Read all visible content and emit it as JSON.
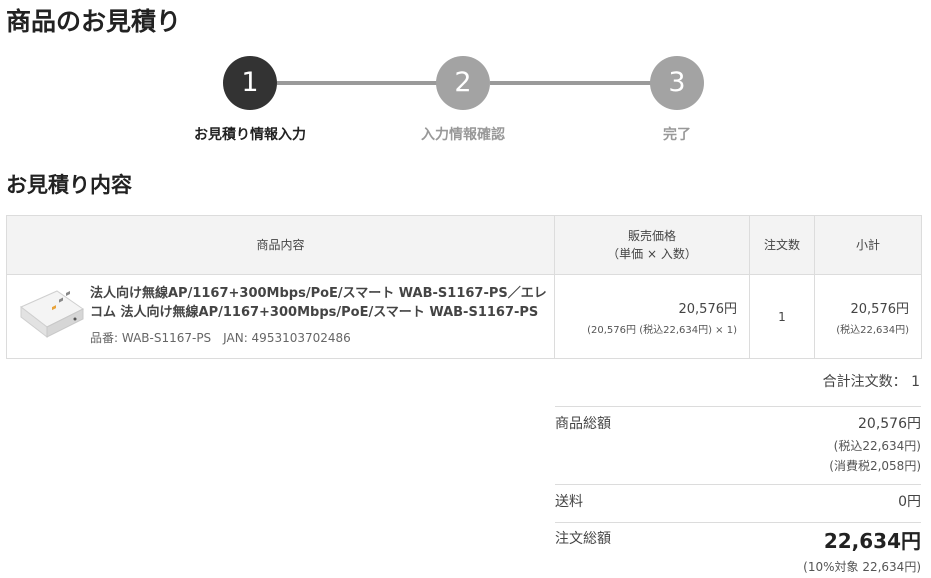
{
  "page": {
    "title": "商品のお見積り"
  },
  "steps": [
    {
      "number": "1",
      "label": "お見積り情報入力"
    },
    {
      "number": "2",
      "label": "入力情報確認"
    },
    {
      "number": "3",
      "label": "完了"
    }
  ],
  "section": {
    "title": "お見積り内容"
  },
  "table": {
    "headers": {
      "product": "商品内容",
      "price_line1": "販売価格",
      "price_line2": "（単価 × 入数）",
      "qty": "注文数",
      "subtotal": "小計"
    },
    "row": {
      "name": "法人向け無線AP/1167+300Mbps/PoE/スマート WAB-S1167-PS／エレコム 法人向け無線AP/1167+300Mbps/PoE/スマート WAB-S1167-PS",
      "code": "品番: WAB-S1167-PS　JAN: 4953103702486",
      "price": "20,576円",
      "price_detail": "(20,576円 (税込22,634円) × 1)",
      "qty": "1",
      "subtotal": "20,576円",
      "subtotal_detail": "(税込22,634円)"
    }
  },
  "total_qty": "合計注文数： 1",
  "summary": {
    "goods_label": "商品総額",
    "goods_value": "20,576円",
    "goods_tax_incl": "(税込22,634円)",
    "goods_tax": "(消費税2,058円)",
    "shipping_label": "送料",
    "shipping_value": "0円",
    "grand_label": "注文総額",
    "grand_value": "22,634円",
    "grand_note": "(10%対象 22,634円)"
  },
  "icons": {
    "product": "access-point-image"
  },
  "colors": {
    "step_active": "#333333",
    "step_inactive": "#a3a3a3",
    "header_bg": "#f3f3f3",
    "border": "#dcdcdc"
  }
}
